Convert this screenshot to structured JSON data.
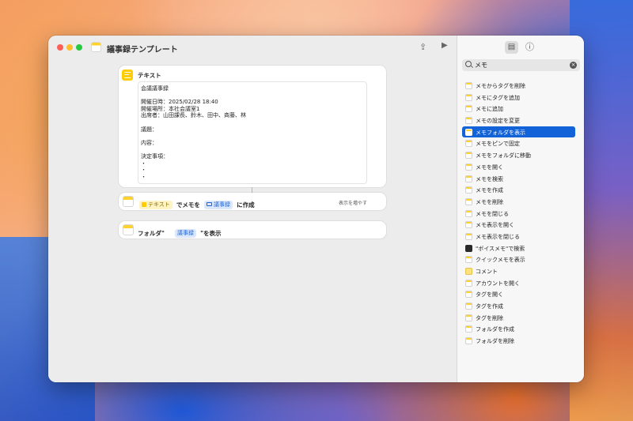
{
  "window": {
    "title": "議事録テンプレート"
  },
  "toolbar": {
    "share_icon": "share-icon",
    "run_icon": "play-icon"
  },
  "actions": {
    "text": {
      "label": "テキスト",
      "lines": [
        "会議議事録",
        "",
        "開催日時：2025/02/28 18:40",
        "開催場所：本社会議室1",
        "出席者：山田課長、鈴木、田中、斉藤、林",
        "",
        "議題：",
        "",
        "内容：",
        "",
        "決定事項：",
        "・",
        "・",
        "・"
      ]
    },
    "create_note": {
      "token1": "テキスト",
      "mid": "でメモを",
      "token2": "議事録",
      "suffix": "に作成",
      "more": "表示を増やす"
    },
    "show_folder": {
      "prefix": "フォルダ\"",
      "token": "議事録",
      "suffix": "\"を表示"
    }
  },
  "sidebar": {
    "search": {
      "value": "メモ"
    },
    "items": [
      {
        "label": "メモからタグを削除",
        "icon": "notes-icon"
      },
      {
        "label": "メモにタグを追加",
        "icon": "notes-icon"
      },
      {
        "label": "メモに追加",
        "icon": "notes-icon"
      },
      {
        "label": "メモの設定を変更",
        "icon": "notes-icon"
      },
      {
        "label": "メモフォルダを表示",
        "icon": "notes-icon",
        "selected": true
      },
      {
        "label": "メモをピンで固定",
        "icon": "notes-icon"
      },
      {
        "label": "メモをフォルダに移動",
        "icon": "notes-icon"
      },
      {
        "label": "メモを開く",
        "icon": "notes-icon"
      },
      {
        "label": "メモを検索",
        "icon": "notes-icon"
      },
      {
        "label": "メモを作成",
        "icon": "notes-icon"
      },
      {
        "label": "メモを削除",
        "icon": "notes-icon"
      },
      {
        "label": "メモを閉じる",
        "icon": "notes-icon"
      },
      {
        "label": "メモ表示を開く",
        "icon": "notes-icon"
      },
      {
        "label": "メモ表示を閉じる",
        "icon": "notes-icon"
      },
      {
        "label": "\"ボイスメモ\"で検索",
        "icon": "voice-memo-icon"
      },
      {
        "label": "クイックメモを表示",
        "icon": "notes-icon"
      },
      {
        "label": "コメント",
        "icon": "comment-icon"
      },
      {
        "label": "アカウントを開く",
        "icon": "notes-icon"
      },
      {
        "label": "タグを開く",
        "icon": "notes-icon"
      },
      {
        "label": "タグを作成",
        "icon": "notes-icon"
      },
      {
        "label": "タグを削除",
        "icon": "notes-icon"
      },
      {
        "label": "フォルダを作成",
        "icon": "notes-icon"
      },
      {
        "label": "フォルダを削除",
        "icon": "notes-icon"
      }
    ]
  },
  "colors": {
    "accent": "#1263d8",
    "notes_yellow": "#ffcc00"
  }
}
